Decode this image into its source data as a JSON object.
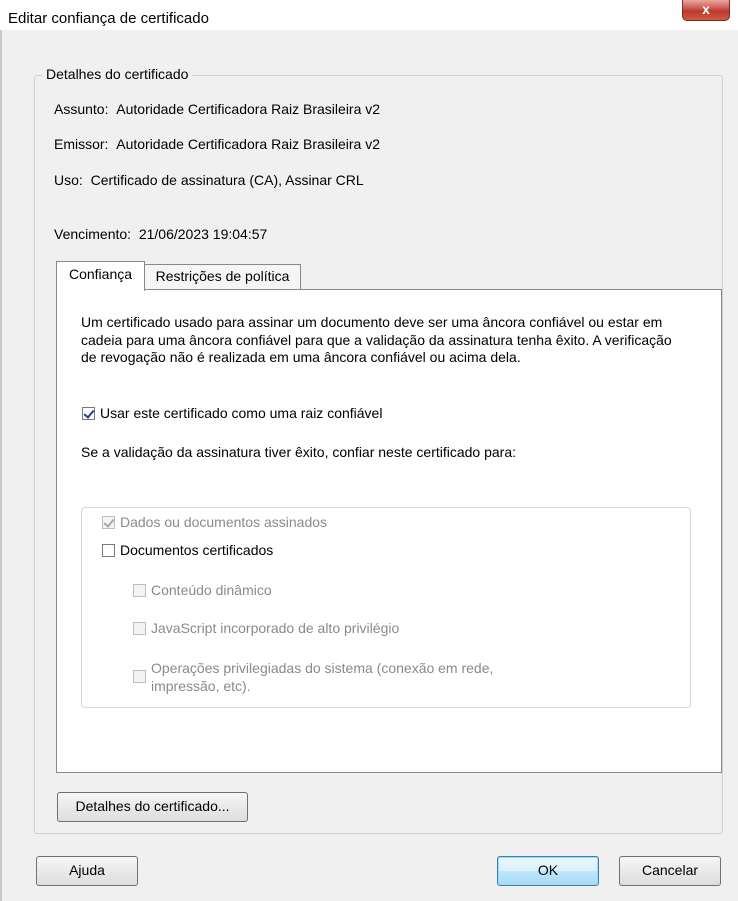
{
  "window": {
    "title": "Editar confiança de certificado",
    "close_glyph": "x"
  },
  "details_group": {
    "legend": "Detalhes do certificado",
    "subject_label": "Assunto:",
    "subject_value": "Autoridade Certificadora Raiz Brasileira v2",
    "issuer_label": "Emissor:",
    "issuer_value": "Autoridade Certificadora Raiz Brasileira v2",
    "usage_label": "Uso:",
    "usage_value": "Certificado de assinatura (CA), Assinar CRL",
    "expiry_label": "Vencimento:",
    "expiry_value": "21/06/2023 19:04:57"
  },
  "tabs": [
    {
      "label": "Confiança",
      "active": true
    },
    {
      "label": "Restrições de política",
      "active": false
    }
  ],
  "trust_tab": {
    "description": "Um certificado usado para assinar um documento deve ser uma âncora confiável ou estar em cadeia para uma âncora confiável para que a validação da assinatura tenha êxito. A verificação de revogação não é realizada em uma âncora confiável ou acima dela.",
    "use_as_root": {
      "label": "Usar este certificado como uma raiz confiável",
      "checked": true
    },
    "validation_text": "Se a validação da assinatura tiver êxito, confiar neste certificado para:",
    "options": [
      {
        "label": "Dados ou documentos assinados",
        "checked": true,
        "disabled": true
      },
      {
        "label": "Documentos certificados",
        "checked": false,
        "disabled": false
      },
      {
        "label": "Conteúdo dinâmico",
        "checked": false,
        "disabled": true
      },
      {
        "label": "JavaScript incorporado de alto privilégio",
        "checked": false,
        "disabled": true
      },
      {
        "label": "Operações privilegiadas do sistema (conexão em rede, impressão, etc).",
        "checked": false,
        "disabled": true
      }
    ]
  },
  "buttons": {
    "certificate_details": "Detalhes do certificado...",
    "help": "Ajuda",
    "ok": "OK",
    "cancel": "Cancelar"
  }
}
